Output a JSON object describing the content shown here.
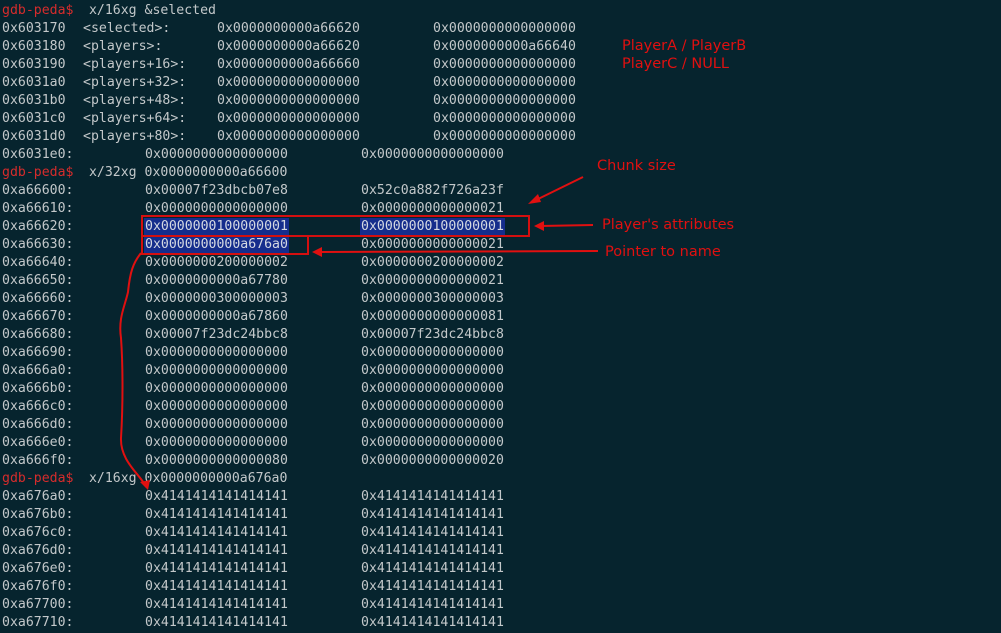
{
  "prompt": "gdb-peda$",
  "block1": {
    "command": " x/16xg &selected",
    "rows": [
      {
        "addr": "0x603170",
        "sym": "<selected>:",
        "v1": "0x0000000000a66620",
        "v2": "0x0000000000000000"
      },
      {
        "addr": "0x603180",
        "sym": "<players>:",
        "v1": "0x0000000000a66620",
        "v2": "0x0000000000a66640"
      },
      {
        "addr": "0x603190",
        "sym": "<players+16>:",
        "v1": "0x0000000000a66660",
        "v2": "0x0000000000000000"
      },
      {
        "addr": "0x6031a0",
        "sym": "<players+32>:",
        "v1": "0x0000000000000000",
        "v2": "0x0000000000000000"
      },
      {
        "addr": "0x6031b0",
        "sym": "<players+48>:",
        "v1": "0x0000000000000000",
        "v2": "0x0000000000000000"
      },
      {
        "addr": "0x6031c0",
        "sym": "<players+64>:",
        "v1": "0x0000000000000000",
        "v2": "0x0000000000000000"
      },
      {
        "addr": "0x6031d0",
        "sym": "<players+80>:",
        "v1": "0x0000000000000000",
        "v2": "0x0000000000000000"
      },
      {
        "addr": "0x6031e0:",
        "sym": "",
        "v1": "0x0000000000000000",
        "v2": "0x0000000000000000"
      }
    ]
  },
  "block2": {
    "command": " x/32xg 0x0000000000a66600",
    "rows": [
      {
        "addr": "0xa66600:",
        "v1": "0x00007f23dbcb07e8",
        "v2": "0x52c0a882f726a23f"
      },
      {
        "addr": "0xa66610:",
        "v1": "0x0000000000000000",
        "v2": "0x0000000000000021"
      },
      {
        "addr": "0xa66620:",
        "v1": "0x0000000100000001",
        "v2": "0x0000000100000001"
      },
      {
        "addr": "0xa66630:",
        "v1": "0x0000000000a676a0",
        "v2": "0x0000000000000021"
      },
      {
        "addr": "0xa66640:",
        "v1": "0x0000000200000002",
        "v2": "0x0000000200000002"
      },
      {
        "addr": "0xa66650:",
        "v1": "0x0000000000a67780",
        "v2": "0x0000000000000021"
      },
      {
        "addr": "0xa66660:",
        "v1": "0x0000000300000003",
        "v2": "0x0000000300000003"
      },
      {
        "addr": "0xa66670:",
        "v1": "0x0000000000a67860",
        "v2": "0x0000000000000081"
      },
      {
        "addr": "0xa66680:",
        "v1": "0x00007f23dc24bbc8",
        "v2": "0x00007f23dc24bbc8"
      },
      {
        "addr": "0xa66690:",
        "v1": "0x0000000000000000",
        "v2": "0x0000000000000000"
      },
      {
        "addr": "0xa666a0:",
        "v1": "0x0000000000000000",
        "v2": "0x0000000000000000"
      },
      {
        "addr": "0xa666b0:",
        "v1": "0x0000000000000000",
        "v2": "0x0000000000000000"
      },
      {
        "addr": "0xa666c0:",
        "v1": "0x0000000000000000",
        "v2": "0x0000000000000000"
      },
      {
        "addr": "0xa666d0:",
        "v1": "0x0000000000000000",
        "v2": "0x0000000000000000"
      },
      {
        "addr": "0xa666e0:",
        "v1": "0x0000000000000000",
        "v2": "0x0000000000000000"
      },
      {
        "addr": "0xa666f0:",
        "v1": "0x0000000000000080",
        "v2": "0x0000000000000020"
      }
    ]
  },
  "block3": {
    "command": " x/16xg 0x0000000000a676a0",
    "rows": [
      {
        "addr": "0xa676a0:",
        "v1": "0x4141414141414141",
        "v2": "0x4141414141414141"
      },
      {
        "addr": "0xa676b0:",
        "v1": "0x4141414141414141",
        "v2": "0x4141414141414141"
      },
      {
        "addr": "0xa676c0:",
        "v1": "0x4141414141414141",
        "v2": "0x4141414141414141"
      },
      {
        "addr": "0xa676d0:",
        "v1": "0x4141414141414141",
        "v2": "0x4141414141414141"
      },
      {
        "addr": "0xa676e0:",
        "v1": "0x4141414141414141",
        "v2": "0x4141414141414141"
      },
      {
        "addr": "0xa676f0:",
        "v1": "0x4141414141414141",
        "v2": "0x4141414141414141"
      },
      {
        "addr": "0xa67700:",
        "v1": "0x4141414141414141",
        "v2": "0x4141414141414141"
      },
      {
        "addr": "0xa67710:",
        "v1": "0x4141414141414141",
        "v2": "0x4141414141414141"
      }
    ]
  },
  "annotations": {
    "players_ab": "PlayerA / PlayerB",
    "players_c": "PlayerC / NULL",
    "chunk_size": "Chunk size",
    "attributes": "Player's attributes",
    "pointer": "Pointer to name"
  },
  "colors": {
    "background": "#06242e",
    "text": "#c3c8ca",
    "prompt": "#d62c2c",
    "highlight": "#152d8c",
    "annotation": "#e01010"
  }
}
